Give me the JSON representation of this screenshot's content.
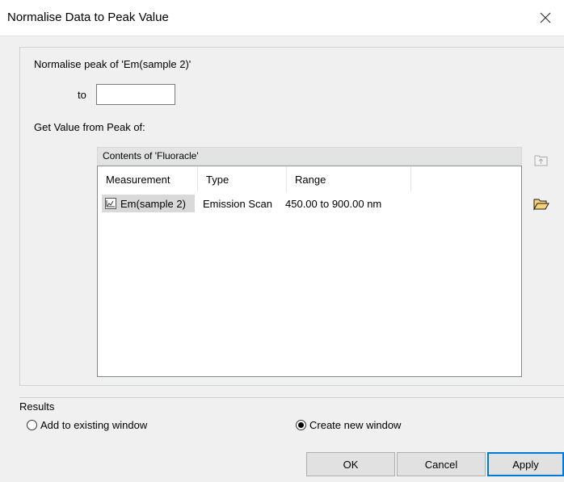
{
  "window": {
    "title": "Normalise Data to Peak Value"
  },
  "normalise": {
    "label": "Normalise peak of  'Em(sample 2)'",
    "to_label": "to",
    "to_value": ""
  },
  "source": {
    "label": "Get Value from Peak of:",
    "contents_label": "Contents of 'Fluoracle'"
  },
  "table": {
    "columns": [
      "Measurement",
      "Type",
      "Range"
    ],
    "rows": [
      {
        "measurement": "Em(sample 2)",
        "type": "Emission Scan",
        "range": "450.00 to 900.00 nm"
      }
    ]
  },
  "results": {
    "label": "Results",
    "options": [
      {
        "label": "Add to existing window",
        "selected": false
      },
      {
        "label": "Create new window",
        "selected": true
      }
    ]
  },
  "buttons": {
    "ok": "OK",
    "cancel": "Cancel",
    "apply": "Apply"
  }
}
